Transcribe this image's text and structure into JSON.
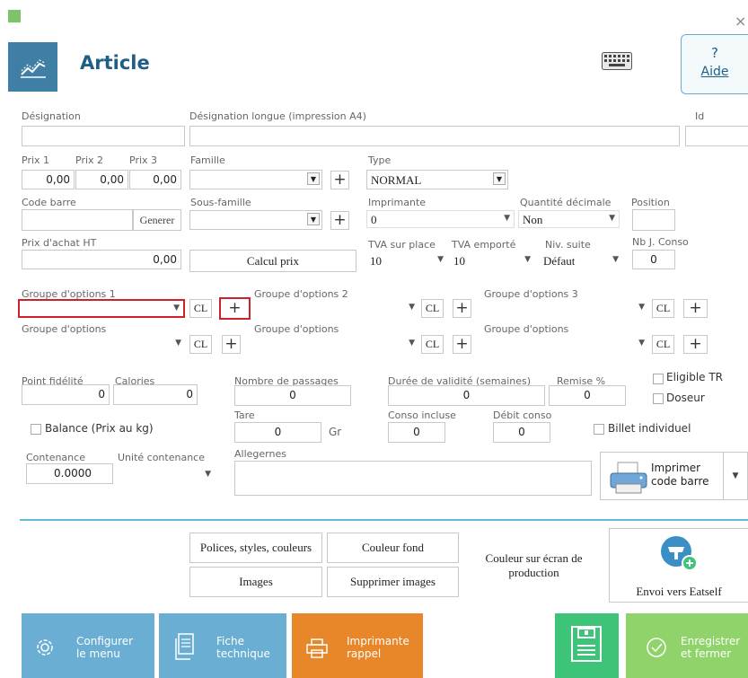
{
  "window": {
    "close": "×"
  },
  "header": {
    "title": "Article",
    "help_q": "?",
    "help_label": "Aide"
  },
  "fields": {
    "designation": {
      "label": "Désignation",
      "value": ""
    },
    "designation_longue": {
      "label": "Désignation longue (impression A4)",
      "value": ""
    },
    "id": {
      "label": "Id",
      "value": ""
    },
    "prix1": {
      "label": "Prix 1",
      "value": "0,00"
    },
    "prix2": {
      "label": "Prix 2",
      "value": "0,00"
    },
    "prix3": {
      "label": "Prix 3",
      "value": "0,00"
    },
    "famille": {
      "label": "Famille",
      "value": ""
    },
    "type": {
      "label": "Type",
      "value": "NORMAL"
    },
    "code_barre": {
      "label": "Code barre",
      "value": "",
      "button": "Generer"
    },
    "sous_famille": {
      "label": "Sous-famille",
      "value": ""
    },
    "imprimante": {
      "label": "Imprimante",
      "value": "0"
    },
    "quantite_decimale": {
      "label": "Quantité décimale",
      "value": "Non"
    },
    "position": {
      "label": "Position",
      "value": ""
    },
    "prix_achat": {
      "label": "Prix d'achat HT",
      "value": "0,00"
    },
    "calcul_prix": "Calcul prix",
    "tva_sur_place": {
      "label": "TVA sur place",
      "value": "10"
    },
    "tva_emporte": {
      "label": "TVA emporté",
      "value": "10"
    },
    "niv_suite": {
      "label": "Niv. suite",
      "value": "Défaut"
    },
    "nb_j_conso": {
      "label": "Nb J. Conso",
      "value": "0"
    }
  },
  "options": {
    "groupe1": "Groupe d'options 1",
    "groupe2": "Groupe d'options 2",
    "groupe3": "Groupe d'options 3",
    "groupe": "Groupe d'options",
    "cl": "CL",
    "plus": "+"
  },
  "details": {
    "point_fidelite": {
      "label": "Point fidélité",
      "value": "0"
    },
    "calories": {
      "label": "Calories",
      "value": "0"
    },
    "nombre_passages": {
      "label": "Nombre de passages",
      "value": "0"
    },
    "duree_validite": {
      "label": "Durée de validité (semaines)",
      "value": "0"
    },
    "remise": {
      "label": "Remise %",
      "value": "0"
    },
    "eligible_tr": "Eligible TR",
    "doseur": "Doseur",
    "balance": "Balance (Prix au kg)",
    "tare": {
      "label": "Tare",
      "value": "0",
      "unit": "Gr"
    },
    "conso_incluse": {
      "label": "Conso incluse",
      "value": "0"
    },
    "debit_conso": {
      "label": "Débit conso",
      "value": "0"
    },
    "billet_individuel": "Billet individuel",
    "contenance": {
      "label": "Contenance",
      "value": "0.0000"
    },
    "unite_contenance": {
      "label": "Unité contenance",
      "value": ""
    },
    "allergenes": {
      "label": "Allegernes",
      "value": ""
    },
    "imprimer_code_barre": {
      "line1": "Imprimer",
      "line2": "code barre"
    }
  },
  "actions": {
    "polices": "Polices, styles, couleurs",
    "couleur_fond": "Couleur fond",
    "images": "Images",
    "supprimer_images": "Supprimer images",
    "couleur_ecran_l1": "Couleur sur écran de",
    "couleur_ecran_l2": "production",
    "envoi_eatself": "Envoi vers Eatself"
  },
  "footer": {
    "configurer_l1": "Configurer",
    "configurer_l2": "le menu",
    "fiche_l1": "Fiche",
    "fiche_l2": "technique",
    "imprimante_l1": "Imprimante",
    "imprimante_l2": "rappel",
    "enregistrer_l1": "Enregistrer",
    "enregistrer_l2": "et fermer"
  },
  "colors": {
    "header_icon_bg": "#3f7fa6",
    "title": "#1f5e86",
    "accent_line": "#67b9d8",
    "btn_blue": "#6aaed4",
    "btn_orange": "#e8862a",
    "btn_green": "#3ec478",
    "btn_green_light": "#8fd36a",
    "highlight_red": "#d0202a",
    "eatself_blue": "#3a8fc6"
  }
}
